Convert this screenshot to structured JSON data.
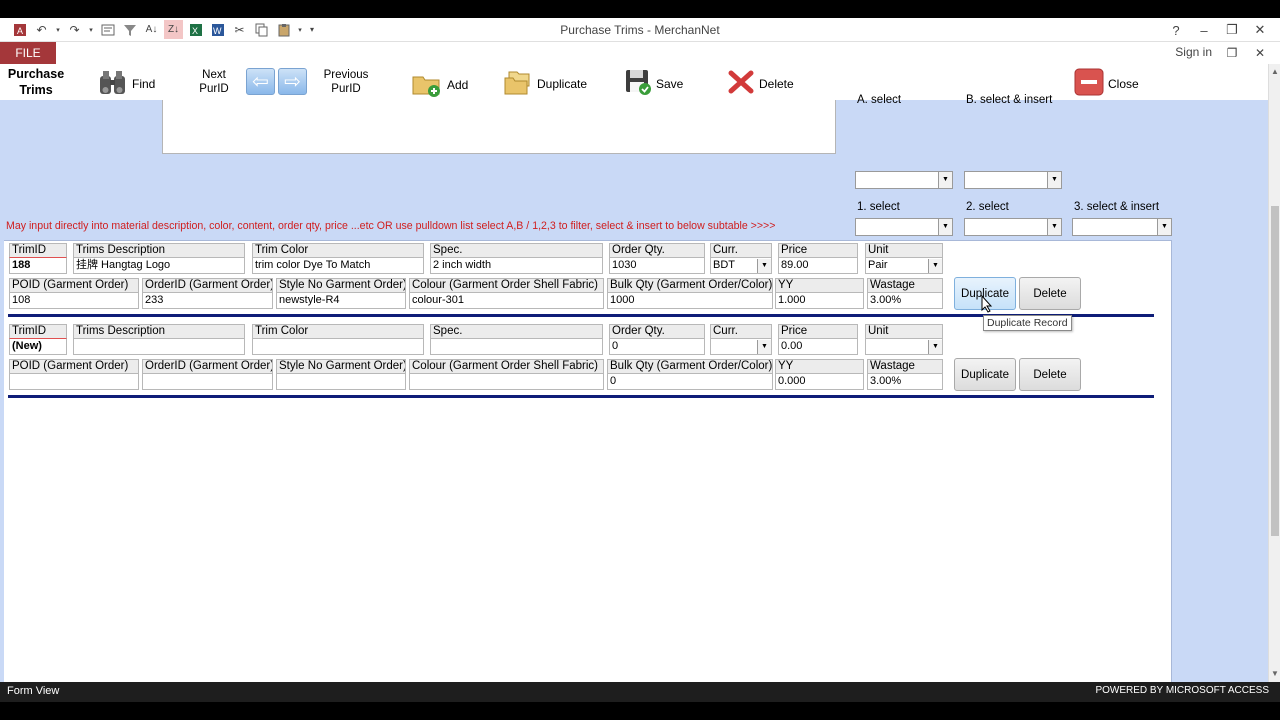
{
  "window": {
    "title": "Purchase Trims - MerchanNet",
    "help": "?",
    "minimize": "–",
    "restore": "🗗",
    "close": "✕"
  },
  "ribbon": {
    "file_tab": "FILE",
    "sign_in": "Sign in"
  },
  "toolbar": {
    "form_title": "Purchase Trims",
    "find": "Find",
    "next": "Next PurID",
    "previous": "Previous PurID",
    "add": "Add",
    "duplicate": "Duplicate",
    "save": "Save",
    "delete": "Delete",
    "close": "Close"
  },
  "filters": {
    "top_a_label": "A. select",
    "top_b_label": "B. select & insert",
    "select1": "1. select",
    "select2": "2. select",
    "select3": "3. select & insert"
  },
  "hint": "May input directly into material description, color, content, order qty, price ...etc OR use pulldown list select A,B / 1,2,3 to filter, select & insert to below subtable >>>>",
  "labels": {
    "trim_id": "TrimID",
    "trims_description": "Trims Description",
    "trim_color": "Trim Color",
    "spec": "Spec.",
    "order_qty": "Order Qty.",
    "curr": "Curr.",
    "price": "Price",
    "unit": "Unit",
    "poid": "POID (Garment Order)",
    "order_id": "OrderID (Garment Order)",
    "style_no": "Style No Garment Order)",
    "colour": "Colour (Garment Order Shell Fabric)",
    "bulk_qty": "Bulk Qty (Garment Order/Color)",
    "yy": "YY",
    "wastage": "Wastage",
    "duplicate_btn": "Duplicate",
    "delete_btn": "Delete"
  },
  "records": [
    {
      "trim_id": "188",
      "trims_description": "挂牌 Hangtag Logo",
      "trim_color": "trim color Dye To Match",
      "spec": "2 inch width",
      "order_qty": "1030",
      "curr": "BDT",
      "price": "89.00",
      "unit": "Pair",
      "poid": "108",
      "order_id": "233",
      "style_no": "newstyle-R4",
      "colour": "colour-301",
      "bulk_qty": "1000",
      "yy": "1.000",
      "wastage": "3.00%"
    },
    {
      "trim_id": "(New)",
      "trims_description": "",
      "trim_color": "",
      "spec": "",
      "order_qty": "0",
      "curr": "",
      "price": "0.00",
      "unit": "",
      "poid": "",
      "order_id": "",
      "style_no": "",
      "colour": "",
      "bulk_qty": "0",
      "yy": "0.000",
      "wastage": "3.00%"
    }
  ],
  "tooltip": "Duplicate Record",
  "status": {
    "view": "Form View",
    "powered": "POWERED BY MICROSOFT ACCESS"
  },
  "colors": {
    "file_tab": "#a4373a",
    "detail_bg": "#c9d9f6",
    "row_divider": "#0e1d78",
    "hint_text": "#d01e1e",
    "status_bar": "#1e1e1e"
  }
}
